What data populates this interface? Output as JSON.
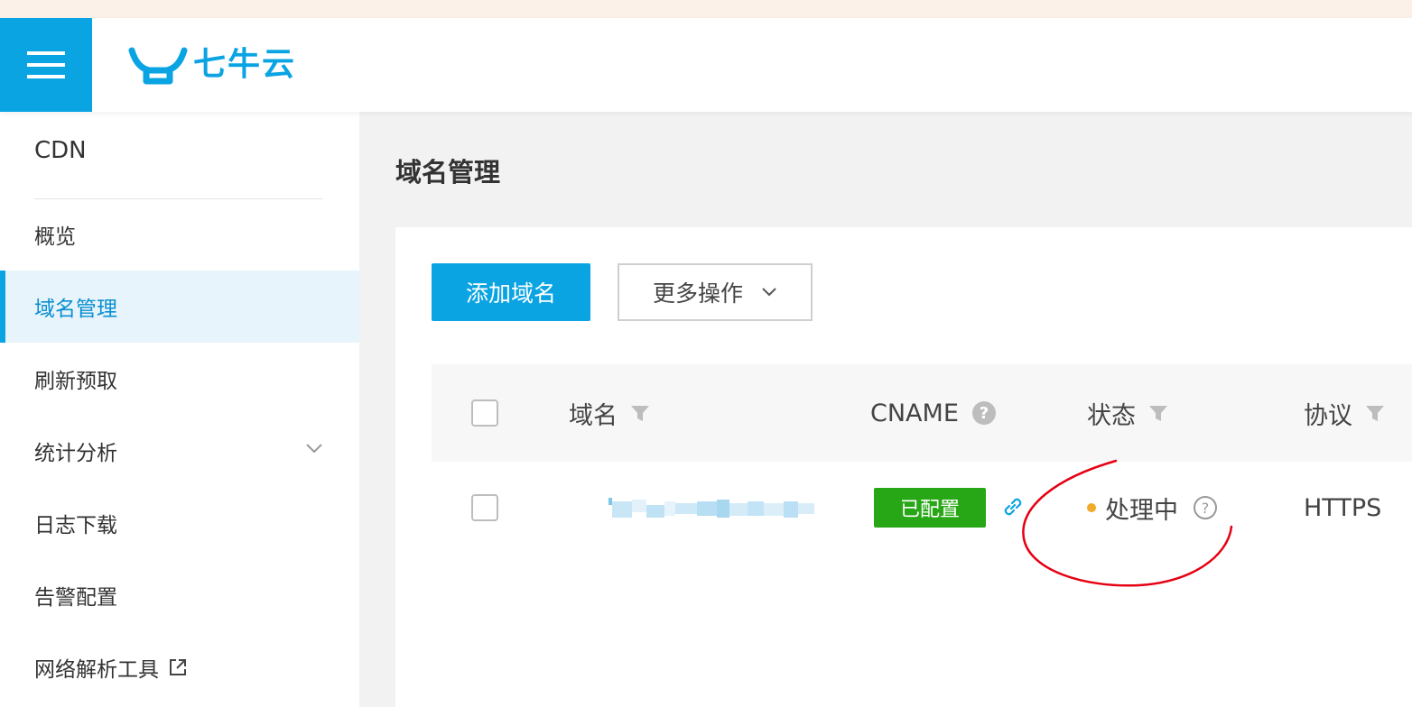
{
  "header": {
    "logo_text": "七牛云",
    "brand_color": "#0aa4e3"
  },
  "sidebar": {
    "title": "CDN",
    "items": [
      {
        "label": "概览",
        "active": false
      },
      {
        "label": "域名管理",
        "active": true
      },
      {
        "label": "刷新预取",
        "active": false
      },
      {
        "label": "统计分析",
        "active": false,
        "expandable": true
      },
      {
        "label": "日志下载",
        "active": false
      },
      {
        "label": "告警配置",
        "active": false
      },
      {
        "label": "网络解析工具",
        "active": false,
        "external": true
      }
    ]
  },
  "main": {
    "page_title": "域名管理",
    "toolbar": {
      "add_label": "添加域名",
      "more_label": "更多操作"
    },
    "table": {
      "headers": {
        "domain": "域名",
        "cname": "CNAME",
        "status": "状态",
        "protocol": "协议"
      },
      "rows": [
        {
          "cname_badge": "已配置",
          "status": "处理中",
          "protocol": "HTTPS"
        }
      ]
    }
  },
  "colors": {
    "accent": "#0aa4e3",
    "badge_green": "#28a716",
    "status_processing": "#f0a928",
    "annotation_red": "#e60012"
  }
}
